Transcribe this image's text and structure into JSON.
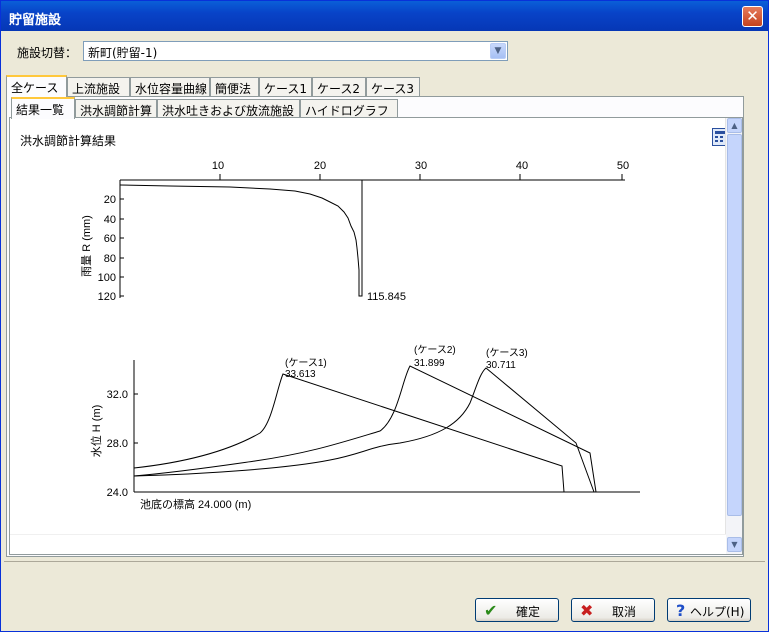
{
  "window": {
    "title": "貯留施設",
    "close_icon": "✕"
  },
  "facility": {
    "label": "施設切替：",
    "value": "新町(貯留-1)"
  },
  "tabs_main": [
    {
      "label": "全ケース"
    },
    {
      "label": "上流施設"
    },
    {
      "label": "水位容量曲線"
    },
    {
      "label": "簡便法"
    },
    {
      "label": "ケース1"
    },
    {
      "label": "ケース2"
    },
    {
      "label": "ケース3"
    }
  ],
  "tabs_sub": [
    {
      "label": "結果一覧"
    },
    {
      "label": "洪水調節計算"
    },
    {
      "label": "洪水吐きおよび放流施設"
    },
    {
      "label": "ハイドログラフ"
    }
  ],
  "content": {
    "title": "洪水調節計算結果"
  },
  "chart_data": [
    {
      "type": "bar",
      "ylabel": "雨量 R (mm)",
      "x_ticks": [
        "10",
        "20",
        "30",
        "40",
        "50"
      ],
      "y_ticks": [
        "20",
        "40",
        "60",
        "80",
        "100",
        "120"
      ],
      "xlim": [
        0,
        50
      ],
      "ylim": [
        0,
        120
      ],
      "annotation": "115.845"
    },
    {
      "type": "line",
      "ylabel": "水位 H (m)",
      "y_ticks": [
        "32.0",
        "28.0",
        "24.0"
      ],
      "ylim": [
        24,
        34
      ],
      "xlabel": "池底の標高 24.000 (m)",
      "series": [
        {
          "name": "(ケース1)",
          "peak": "33.613"
        },
        {
          "name": "(ケース2)",
          "peak": "31.899"
        },
        {
          "name": "(ケース3)",
          "peak": "30.711"
        }
      ]
    }
  ],
  "buttons": {
    "ok": "確定",
    "ok_icon": "✔",
    "cancel": "取消",
    "cancel_icon": "✖",
    "help": "ヘルプ(H)",
    "help_icon": "?"
  }
}
